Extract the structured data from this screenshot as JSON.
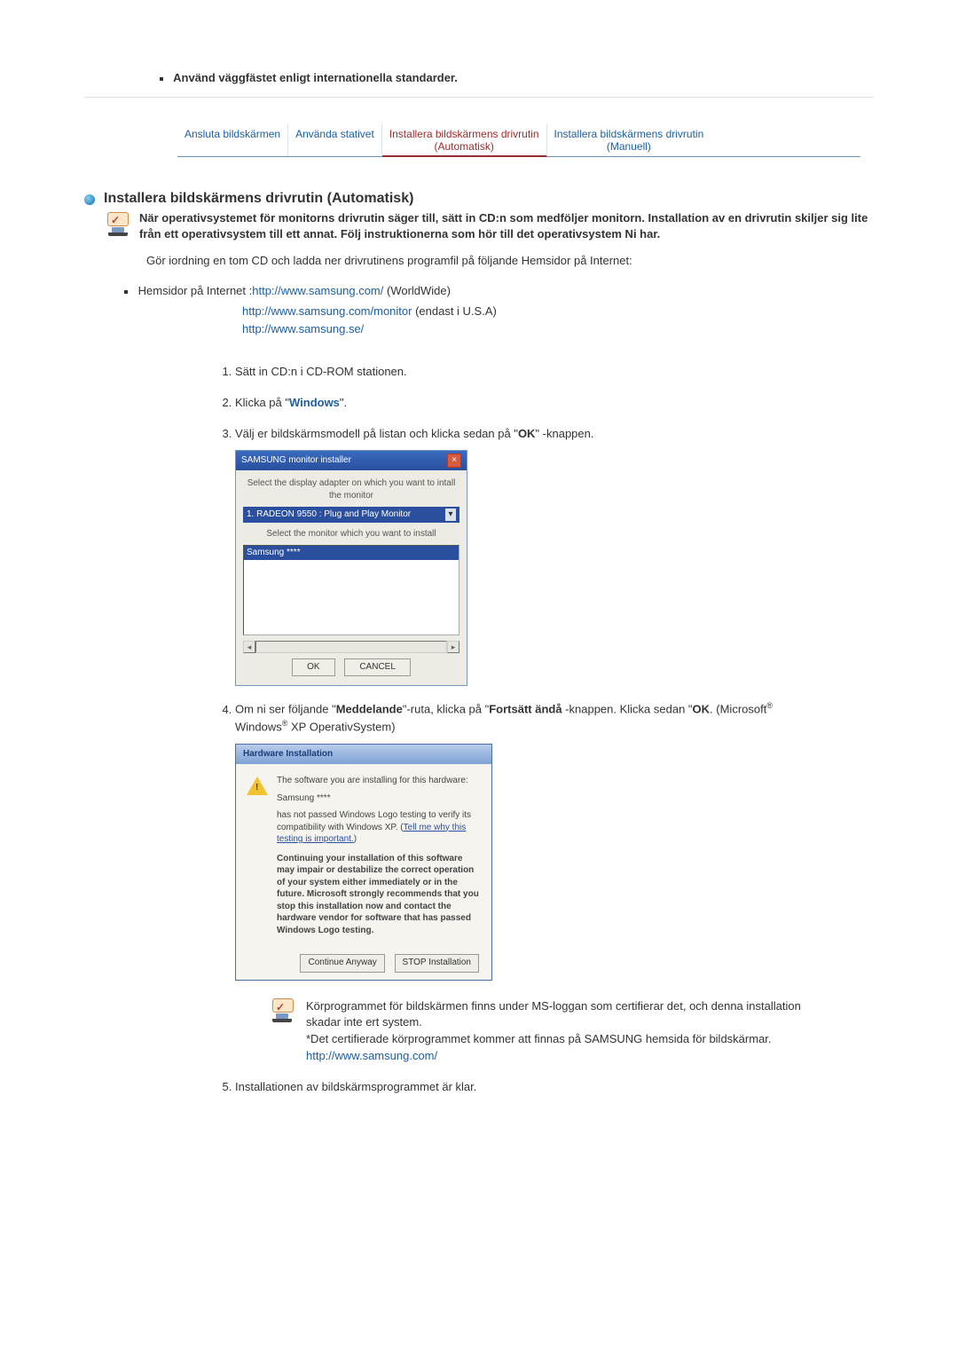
{
  "top_bullet": "Använd väggfästet enligt internationella standarder.",
  "tabs": {
    "t1": "Ansluta bildskärmen",
    "t2": "Använda stativet",
    "t3_line1": "Installera bildskärmens drivrutin",
    "t3_line2": "(Automatisk)",
    "t4_line1": "Installera bildskärmens drivrutin",
    "t4_line2": "(Manuell)"
  },
  "section": {
    "title": "Installera bildskärmens drivrutin (Automatisk)",
    "bold": "När operativsystemet för monitorns drivrutin säger till, sätt in CD:n som medföljer monitorn. Installation av en drivrutin skiljer sig lite från ett operativsystem till ett annat. Följ instruktionerna som hör till det operativsystem Ni har.",
    "para": "Gör iordning en tom CD och ladda ner drivrutinens programfil på följande Hemsidor på Internet:"
  },
  "links": {
    "lead": "Hemsidor på Internet :",
    "url1": "http://www.samsung.com/",
    "note1": " (WorldWide)",
    "url2": "http://www.samsung.com/monitor",
    "note2": " (endast i U.S.A)",
    "url3": "http://www.samsung.se/"
  },
  "steps": {
    "s1": "Sätt in CD:n i CD-ROM stationen.",
    "s2_pre": "Klicka på \"",
    "s2_word": "Windows",
    "s2_post": "\".",
    "s3_pre": "Välj er bildskärmsmodell på listan och klicka sedan på \"",
    "s3_ok": "OK",
    "s3_post": "\" -knappen.",
    "s4_a": "Om ni ser följande \"",
    "s4_medd": "Meddelande",
    "s4_b": "\"-ruta, klicka på \"",
    "s4_fort": "Fortsätt ändå",
    "s4_c": " -knappen. Klicka sedan \"",
    "s4_ok": "OK",
    "s4_d": ". (Microsoft",
    "s4_win": " Windows",
    "s4_xp": " XP OperativSystem)",
    "s5": "Installationen av bildskärmsprogrammet är klar."
  },
  "installer": {
    "title": "SAMSUNG monitor installer",
    "lbl1": "Select the display adapter on which you want to intall the monitor",
    "combo": "1. RADEON 9550 : Plug and Play Monitor",
    "lbl2": "Select the monitor which you want to install",
    "item": "Samsung ****",
    "ok": "OK",
    "cancel": "CANCEL"
  },
  "hwdlg": {
    "title": "Hardware Installation",
    "l1": "The software you are installing for this hardware:",
    "l2": "Samsung ****",
    "l3a": "has not passed Windows Logo testing to verify its compatibility with Windows XP. (",
    "l3u": "Tell me why this testing is important.",
    "l3b": ")",
    "bold": "Continuing your installation of this software may impair or destabilize the correct operation of your system either immediately or in the future. Microsoft strongly recommends that you stop this installation now and contact the hardware vendor for software that has passed Windows Logo testing.",
    "btn1": "Continue Anyway",
    "btn2": "STOP Installation"
  },
  "note": {
    "l1": "Körprogrammet för bildskärmen finns under MS-loggan som certifierar det, och denna installation skadar inte ert system.",
    "l2": "*Det certifierade körprogrammet kommer att finnas på SAMSUNG hemsida för bildskärmar.",
    "url": "http://www.samsung.com/"
  }
}
